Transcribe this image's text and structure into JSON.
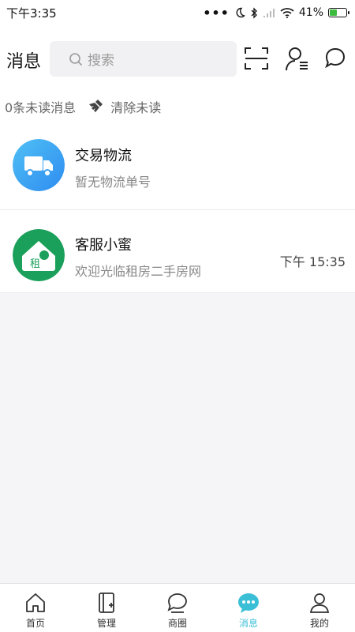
{
  "status": {
    "time": "下午3:35",
    "battery": "41%"
  },
  "header": {
    "title": "消息",
    "search_placeholder": "搜索"
  },
  "unread": {
    "count_text": "0条未读消息",
    "clear_label": "清除未读"
  },
  "conversations": [
    {
      "name": "交易物流",
      "preview": "暂无物流单号",
      "time": "",
      "avatar_icon": "truck-icon",
      "avatar_color": "#3aa8f5"
    },
    {
      "name": "客服小蜜",
      "preview": "欢迎光临租房二手房网",
      "time": "下午 15:35",
      "avatar_icon": "house-logo-icon",
      "avatar_color": "#1aa05a"
    }
  ],
  "avatar_text": "租",
  "tabs": [
    {
      "label": "首页",
      "icon": "home-icon",
      "active": false
    },
    {
      "label": "管理",
      "icon": "manage-icon",
      "active": false
    },
    {
      "label": "商圈",
      "icon": "chat-bubble-icon",
      "active": false
    },
    {
      "label": "消息",
      "icon": "message-icon",
      "active": true
    },
    {
      "label": "我的",
      "icon": "user-icon",
      "active": false
    }
  ],
  "colors": {
    "accent": "#3bbfd6",
    "truck_bg": "#3aa8f5",
    "logo_bg": "#1aa05a"
  }
}
